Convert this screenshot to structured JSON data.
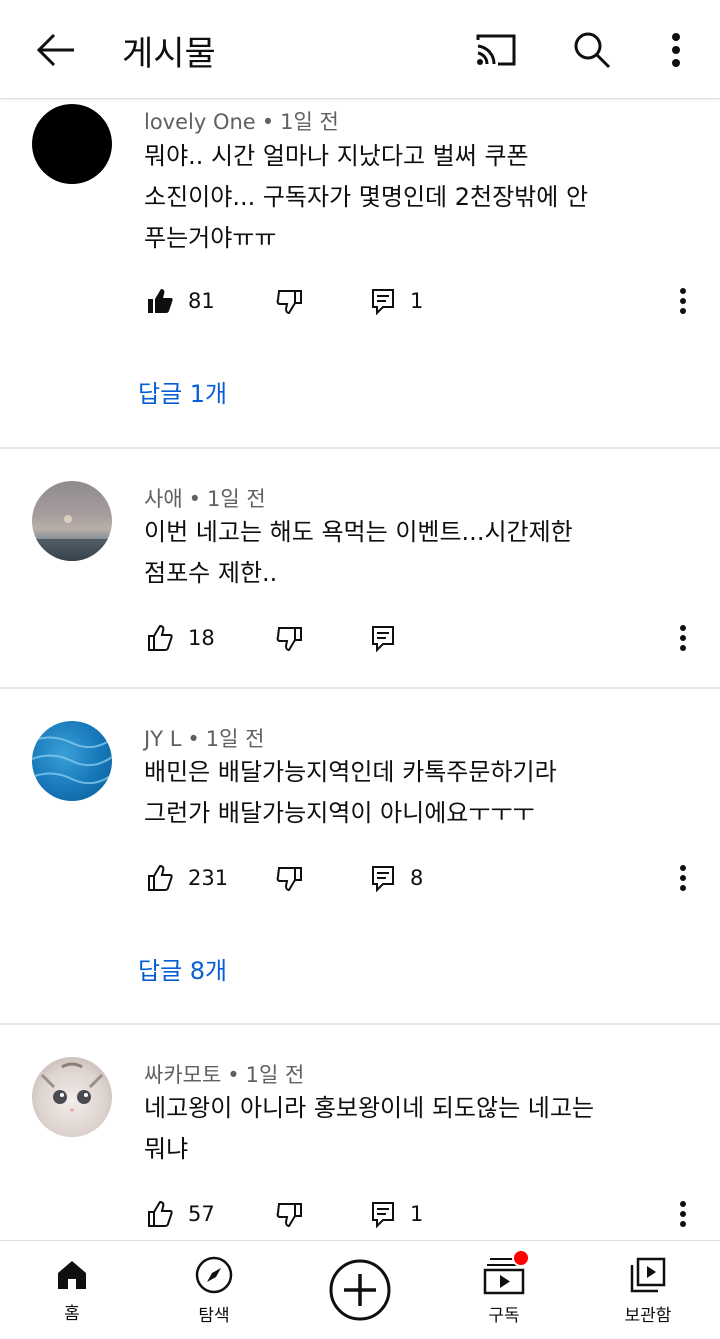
{
  "header": {
    "title": "게시물",
    "icons": [
      "back-arrow-icon",
      "cast-icon",
      "search-icon",
      "more-vert-icon"
    ]
  },
  "comments": [
    {
      "author": "lovely One",
      "time": "1일 전",
      "text_lines": [
        "뭐야.. 시간 얼마나 지났다고 벌써 쿠폰",
        "소진이야...  구독자가 몇명인데 2천장밖에 안",
        "푸는거야ㅠㅠ"
      ],
      "likes": "81",
      "liked": true,
      "reply_count": "1",
      "replies_label": "답글 1개"
    },
    {
      "author": "사애",
      "time": "1일 전",
      "text_lines": [
        "이번 네고는 해도 욕먹는 이벤트...시간제한",
        "점포수 제한.."
      ],
      "likes": "18",
      "liked": false,
      "reply_count": "",
      "replies_label": ""
    },
    {
      "author": "JY L",
      "time": "1일 전",
      "text_lines": [
        "배민은 배달가능지역인데 카톡주문하기라",
        "그런가 배달가능지역이 아니에요ㅜㅜㅜ"
      ],
      "likes": "231",
      "liked": false,
      "reply_count": "8",
      "replies_label": "답글 8개"
    },
    {
      "author": "싸카모토",
      "time": "1일 전",
      "text_lines": [
        "네고왕이 아니라 홍보왕이네 되도않는 네고는",
        "뭐냐"
      ],
      "likes": "57",
      "liked": false,
      "reply_count": "1",
      "replies_label": ""
    }
  ],
  "separator": "•",
  "bottom_nav": {
    "home": "홈",
    "explore": "탐색",
    "subscriptions": "구독",
    "library": "보관함"
  },
  "colors": {
    "link": "#065fd4",
    "meta": "#606060",
    "notification": "#ff0000"
  }
}
